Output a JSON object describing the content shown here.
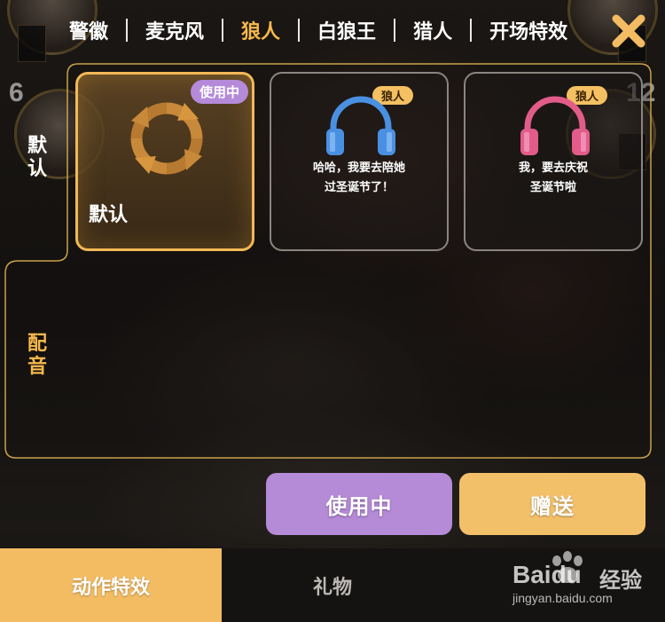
{
  "top_tabs": [
    {
      "label": "警徽",
      "active": false
    },
    {
      "label": "麦克风",
      "active": false
    },
    {
      "label": "狼人",
      "active": true
    },
    {
      "label": "白狼王",
      "active": false
    },
    {
      "label": "猎人",
      "active": false
    },
    {
      "label": "开场特效",
      "active": false
    }
  ],
  "close_icon": "close-x-icon",
  "background_seats": {
    "left_number": "6",
    "right_number": "12"
  },
  "side_tabs": {
    "default": "默\n认",
    "dubbing": "配\n音"
  },
  "cards": [
    {
      "label": "默认",
      "badge": "使用中",
      "icon": "refresh-cycle-icon",
      "selected": true
    },
    {
      "tag": "狼人",
      "line1": "哈哈，我要去陪她",
      "line2": "过圣诞节了！",
      "icon": "headphones-icon",
      "icon_color": "#4a90e2"
    },
    {
      "tag": "狼人",
      "line1": "我，要去庆祝",
      "line2": "圣诞节啦",
      "icon": "headphones-icon",
      "icon_color": "#e25c8a"
    }
  ],
  "buttons": {
    "in_use": "使用中",
    "gift": "赠送"
  },
  "bottom_nav": [
    {
      "label": "动作特效",
      "active": true
    },
    {
      "label": "礼物",
      "active": false
    },
    {
      "label": "",
      "active": false
    }
  ],
  "watermark": {
    "brand": "Baidu",
    "cn": "经验",
    "url": "jingyan.baidu.com"
  },
  "colors": {
    "accent_gold": "#f3bc63",
    "active_purple": "#b58ad6",
    "panel_border": "#c9a24a"
  }
}
